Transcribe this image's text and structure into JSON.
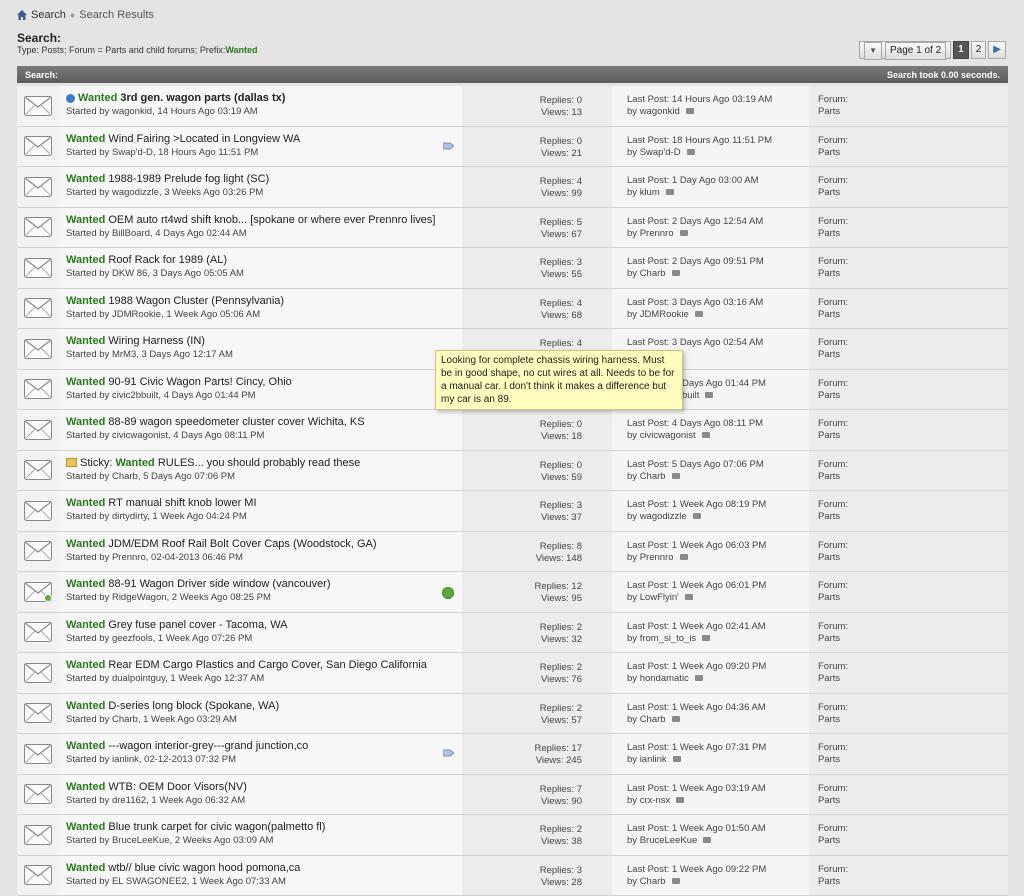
{
  "breadcrumb": {
    "home": "Search",
    "current": "Search Results"
  },
  "search": {
    "title": "Search:",
    "meta_text": "Type: Posts; Forum = Parts and child forums; Prefix:",
    "meta_prefix": "Wanted"
  },
  "pager": {
    "label": "Page 1 of 2",
    "pages": [
      "1",
      "2"
    ]
  },
  "header_bar": {
    "left": "Search:",
    "right": "Search took 0.00 seconds."
  },
  "labels": {
    "replies": "Replies: ",
    "views": "Views: ",
    "last_post": "Last Post: ",
    "by": "by ",
    "forum": "Forum:",
    "started": "Started by "
  },
  "tooltip": {
    "text": "Looking for complete chassis wiring harness. Must be in good shape, no cut wires at all. Needs to be for a manual car. I don't think it makes a difference but my car is an 89."
  },
  "threads": [
    {
      "prefix": "Wanted",
      "title": "3rd gen. wagon parts (dallas tx)",
      "bold": true,
      "lockicon": true,
      "starter": "wagonkid, 14 Hours Ago 03:19 AM",
      "replies": "0",
      "views": "13",
      "last_time": "14 Hours Ago 03:19 AM",
      "last_by": "wagonkid",
      "forum": "Parts"
    },
    {
      "prefix": "Wanted",
      "title": "Wind Fairing >Located in Longview WA",
      "starter": "Swap'd-D, 18 Hours Ago 11:51 PM",
      "replies": "0",
      "views": "21",
      "last_time": "18 Hours Ago 11:51 PM",
      "last_by": "Swap'd-D",
      "forum": "Parts",
      "tag": true
    },
    {
      "prefix": "Wanted",
      "title": "1988-1989 Prelude fog light (SC)",
      "starter": "wagodizzle, 3 Weeks Ago 03:26 PM",
      "replies": "4",
      "views": "99",
      "last_time": "1 Day Ago 03:00 AM",
      "last_by": "klum",
      "forum": "Parts"
    },
    {
      "prefix": "Wanted",
      "title": "OEM auto rt4wd shift knob... [spokane or where ever Prennro lives]",
      "starter": "BillBoard, 4 Days Ago 02:44 AM",
      "replies": "5",
      "views": "67",
      "last_time": "2 Days Ago 12:54 AM",
      "last_by": "Prennro",
      "forum": "Parts"
    },
    {
      "prefix": "Wanted",
      "title": "Roof Rack for 1989 (AL)",
      "starter": "DKW 86, 3 Days Ago 05:05 AM",
      "replies": "3",
      "views": "55",
      "last_time": "2 Days Ago 09:51 PM",
      "last_by": "Charb",
      "forum": "Parts"
    },
    {
      "prefix": "Wanted",
      "title": "1988 Wagon Cluster (Pennsylvania)",
      "starter": "JDMRookie, 1 Week Ago 05:06 AM",
      "replies": "4",
      "views": "68",
      "last_time": "3 Days Ago 03:16 AM",
      "last_by": "JDMRookie",
      "forum": "Parts"
    },
    {
      "prefix": "Wanted",
      "title": "Wiring Harness (IN)",
      "starter": "MrM3, 3 Days Ago 12:17 AM",
      "replies": "4",
      "views": "",
      "last_time": "3 Days Ago 02:54 AM",
      "last_by": "",
      "forum": "Parts"
    },
    {
      "prefix": "Wanted",
      "title": "90-91 Civic Wagon Parts! Cincy, Ohio",
      "starter": "civic2bbuilt, 4 Days Ago 01:44 PM",
      "replies": "",
      "views": "",
      "last_time": "Days Ago 01:44 PM",
      "last_by": "built",
      "forum": "Parts",
      "covered": true
    },
    {
      "prefix": "Wanted",
      "title": "88-89 wagon speedometer cluster cover Wichita, KS",
      "starter": "civicwagonist, 4 Days Ago 08:11 PM",
      "replies": "0",
      "views": "18",
      "last_time": "4 Days Ago 08:11 PM",
      "last_by": "civicwagonist",
      "forum": "Parts"
    },
    {
      "sticky": "Sticky: ",
      "prefix": "Wanted",
      "title": "RULES... you should probably read these",
      "starter": "Charb, 5 Days Ago 07:06 PM",
      "replies": "0",
      "views": "59",
      "last_time": "5 Days Ago 07:06 PM",
      "last_by": "Charb",
      "forum": "Parts",
      "stickyicon": true
    },
    {
      "prefix": "Wanted",
      "title": "RT manual shift knob lower MI",
      "starter": "dirtydirty, 1 Week Ago 04:24 PM",
      "replies": "3",
      "views": "37",
      "last_time": "1 Week Ago 08:19 PM",
      "last_by": "wagodizzle",
      "forum": "Parts"
    },
    {
      "prefix": "Wanted",
      "title": "JDM/EDM Roof Rail Bolt Cover Caps (Woodstock, GA)",
      "starter": "Prennro, 02-04-2013 06:46 PM",
      "replies": "8",
      "views": "148",
      "last_time": "1 Week Ago 06:03 PM",
      "last_by": "Prennro",
      "forum": "Parts"
    },
    {
      "prefix": "Wanted",
      "title": "88-91 Wagon Driver side window (vancouver)",
      "starter": "RidgeWagon, 2 Weeks Ago 08:25 PM",
      "replies": "12",
      "views": "95",
      "last_time": "1 Week Ago 06:01 PM",
      "last_by": "LowFlyin'",
      "forum": "Parts",
      "check": true,
      "greenenv": true
    },
    {
      "prefix": "Wanted",
      "title": "Grey fuse panel cover - Tacoma, WA",
      "starter": "geezfools, 1 Week Ago 07:26 PM",
      "replies": "2",
      "views": "32",
      "last_time": "1 Week Ago 02:41 AM",
      "last_by": "from_si_to_is",
      "forum": "Parts"
    },
    {
      "prefix": "Wanted",
      "title": "Rear EDM Cargo Plastics and Cargo Cover, San Diego California",
      "starter": "dualpointguy, 1 Week Ago 12:37 AM",
      "replies": "2",
      "views": "76",
      "last_time": "1 Week Ago 09:20 PM",
      "last_by": "hondamatic",
      "forum": "Parts"
    },
    {
      "prefix": "Wanted",
      "title": "D-series long block (Spokane, WA)",
      "starter": "Charb, 1 Week Ago 03:29 AM",
      "replies": "2",
      "views": "57",
      "last_time": "1 Week Ago 04:36 AM",
      "last_by": "Charb",
      "forum": "Parts"
    },
    {
      "prefix": "Wanted",
      "title": "---wagon interior-grey---grand junction,co",
      "starter": "ianlink, 02-12-2013 07:32 PM",
      "replies": "17",
      "views": "245",
      "last_time": "1 Week Ago 07:31 PM",
      "last_by": "ianlink",
      "forum": "Parts",
      "tag": true
    },
    {
      "prefix": "Wanted",
      "title": "WTB: OEM Door Visors(NV)",
      "starter": "dre1162, 1 Week Ago 06:32 AM",
      "replies": "7",
      "views": "90",
      "last_time": "1 Week Ago 03:19 AM",
      "last_by": "crx-nsx",
      "forum": "Parts"
    },
    {
      "prefix": "Wanted",
      "title": "Blue trunk carpet for civic wagon(palmetto fl)",
      "starter": "BruceLeeKue, 2 Weeks Ago 03:09 AM",
      "replies": "2",
      "views": "38",
      "last_time": "1 Week Ago 01:50 AM",
      "last_by": "BruceLeeKue",
      "forum": "Parts"
    },
    {
      "prefix": "Wanted",
      "title": "wtb// blue civic wagon hood pomona,ca",
      "starter": "EL SWAGONEE2, 1 Week Ago 07:33 AM",
      "replies": "3",
      "views": "28",
      "last_time": "1 Week Ago 09:22 PM",
      "last_by": "Charb",
      "forum": "Parts"
    }
  ]
}
